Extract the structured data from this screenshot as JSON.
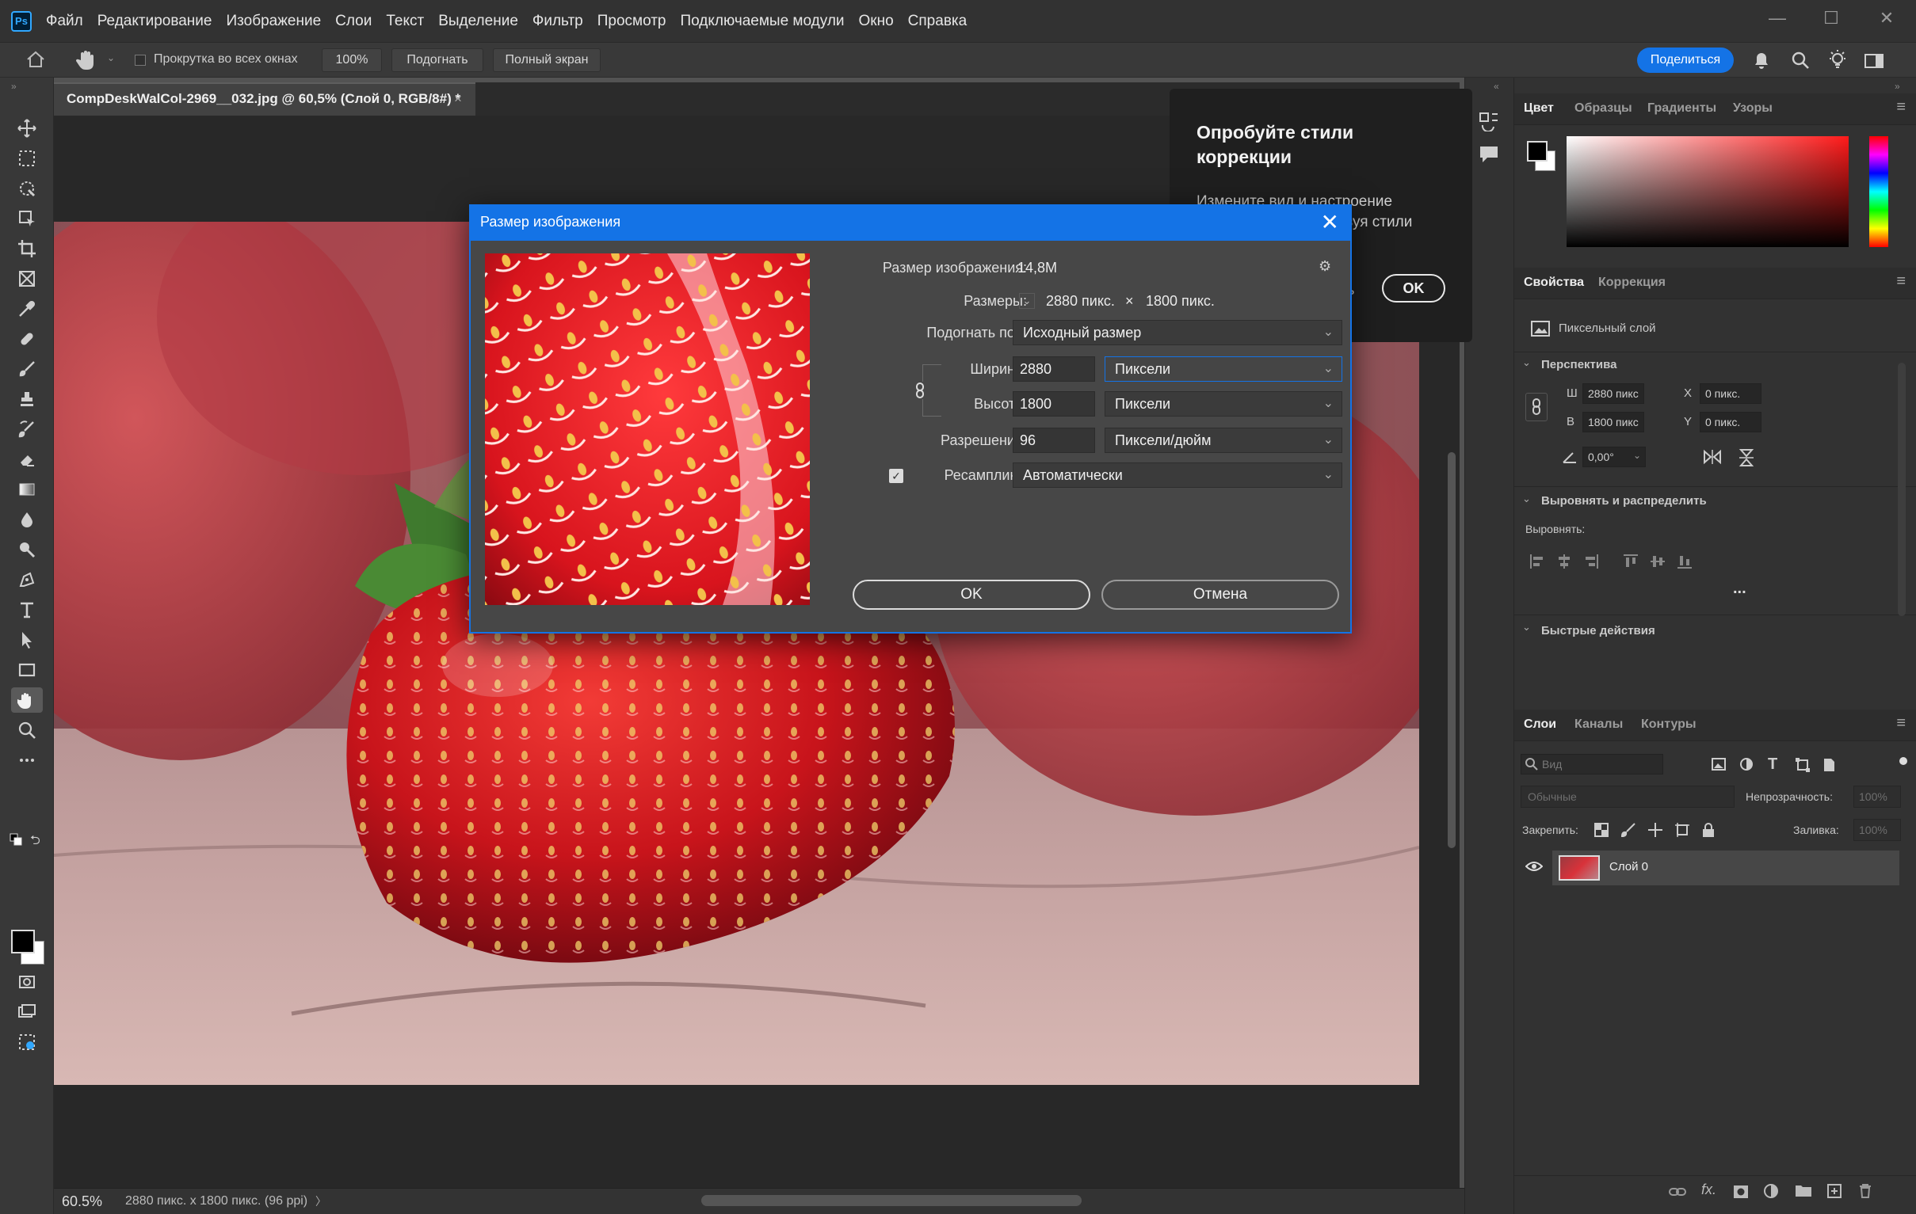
{
  "app": {
    "logo": "Ps",
    "menu": [
      "Файл",
      "Редактирование",
      "Изображение",
      "Слои",
      "Текст",
      "Выделение",
      "Фильтр",
      "Просмотр",
      "Подключаемые модули",
      "Окно",
      "Справка"
    ],
    "window_controls": [
      "—",
      "☐",
      "✕"
    ]
  },
  "options_bar": {
    "scroll_all_windows": "Прокрутка во всех окнах",
    "zoom_100": "100%",
    "fit": "Подогнать",
    "full_screen": "Полный экран",
    "share": "Поделиться"
  },
  "document": {
    "tab_title": "CompDeskWalCol-2969__032.jpg @ 60,5% (Слой 0, RGB/8#) *",
    "close": "×"
  },
  "status": {
    "zoom": "60.5%",
    "info": "2880 пикс. x 1800 пикс. (96 ppi)",
    "arrow": "〉"
  },
  "tooltip": {
    "heading": "Опробуйте стили коррекции",
    "body": "Измените вид и настроение изображения, используя стили коррекции.",
    "more": "ь",
    "ok": "OK"
  },
  "dialog": {
    "title": "Размер изображения",
    "close": "✕",
    "image_size_label": "Размер изображения:",
    "image_size_value": "14,8M",
    "dimensions_label": "Размеры:",
    "dim_width": "2880 пикс.",
    "dim_times": "×",
    "dim_height": "1800 пикс.",
    "fit_to_label": "Подогнать под:",
    "fit_to_value": "Исходный размер",
    "width_label": "Ширина:",
    "width_value": "2880",
    "width_unit": "Пиксели",
    "height_label": "Высота:",
    "height_value": "1800",
    "height_unit": "Пиксели",
    "resolution_label": "Разрешение:",
    "resolution_value": "96",
    "resolution_unit": "Пиксели/дюйм",
    "resample_label": "Ресамплинг:",
    "resample_checked": true,
    "resample_value": "Автоматически",
    "ok": "OK",
    "cancel": "Отмена"
  },
  "panels": {
    "color_tabs": [
      "Цвет",
      "Образцы",
      "Градиенты",
      "Узоры"
    ],
    "props_tabs": [
      "Свойства",
      "Коррекция"
    ],
    "pixel_layer": "Пиксельный слой",
    "perspective": "Перспектива",
    "w_label": "Ш",
    "w_value": "2880 пикс",
    "h_label": "В",
    "h_value": "1800 пикс",
    "x_label": "X",
    "x_value": "0 пикс.",
    "y_label": "Y",
    "y_value": "0 пикс.",
    "angle_value": "0,00°",
    "align_distribute": "Выровнять и распределить",
    "align_label": "Выровнять:",
    "more": "...",
    "quick_actions": "Быстрые действия",
    "layers_tabs": [
      "Слои",
      "Каналы",
      "Контуры"
    ],
    "search_placeholder": "Вид",
    "blend_mode": "Обычные",
    "opacity_label": "Непрозрачность:",
    "opacity_value": "100%",
    "lock_label": "Закрепить:",
    "fill_label": "Заливка:",
    "fill_value": "100%",
    "layer_name": "Слой 0"
  },
  "colors": {
    "accent": "#1473e6",
    "foreground": "#000000",
    "background": "#ffffff",
    "hue_base": "#ff1a1a"
  }
}
